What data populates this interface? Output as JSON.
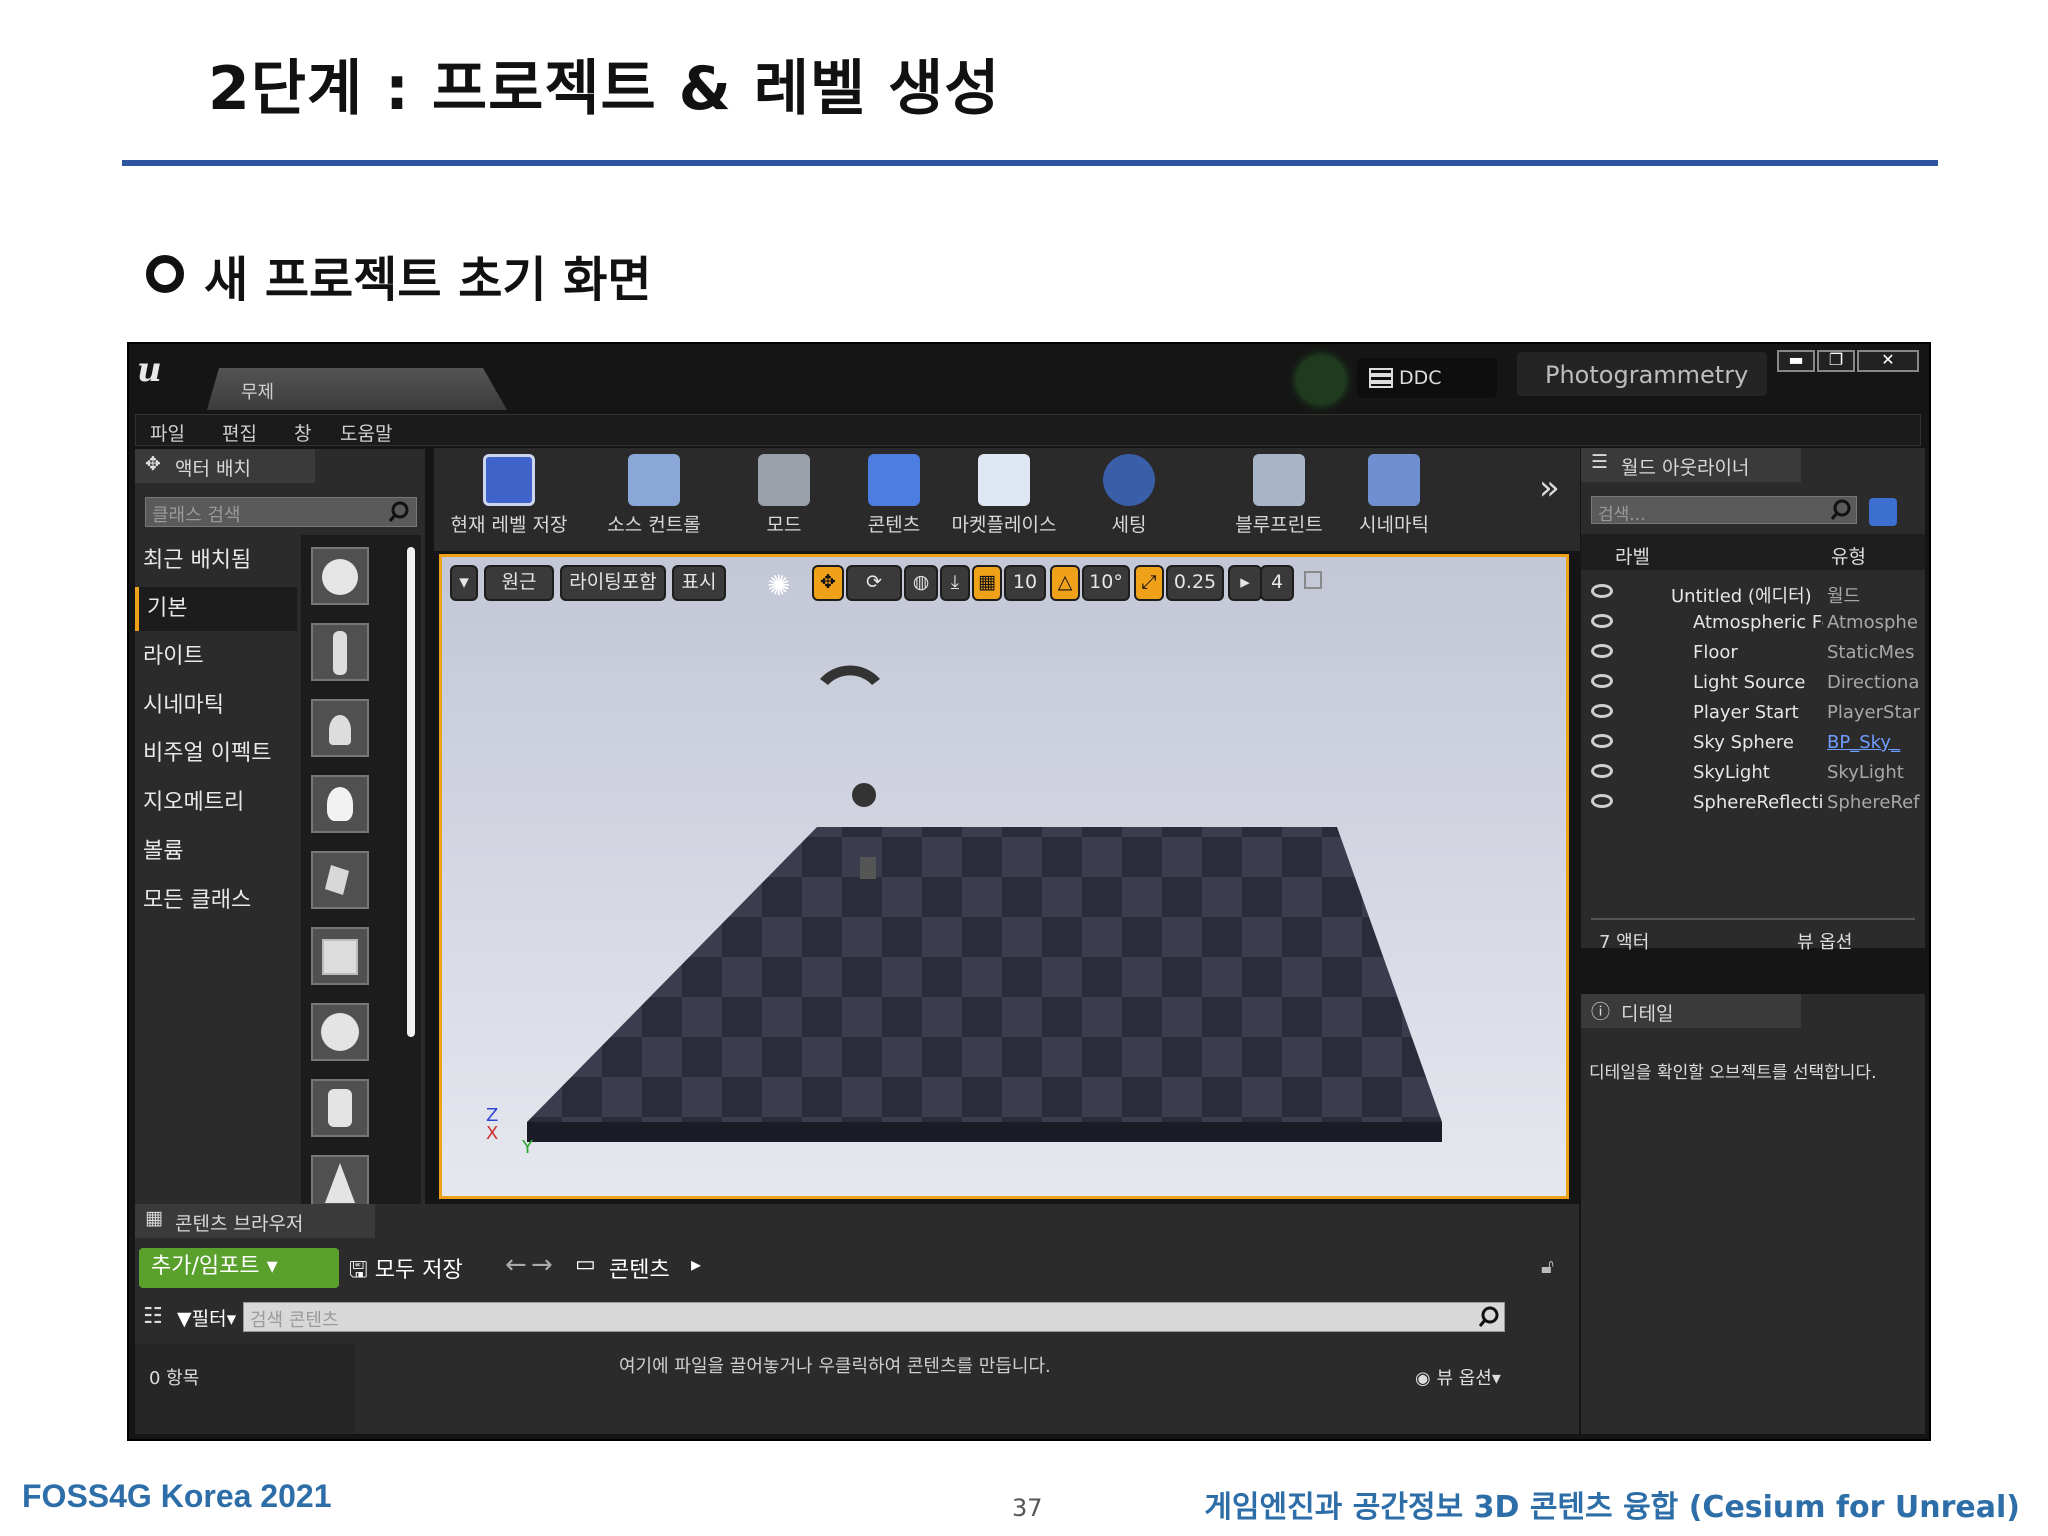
{
  "slide": {
    "title": "2단계 : 프로젝트 & 레벨 생성",
    "subtitle": "새 프로젝트 초기 화면",
    "footer_left": "FOSS4G Korea 2021",
    "page_number": "37",
    "footer_right": "게임엔진과 공간정보 3D 콘텐츠 융합 (Cesium for Unreal)",
    "accent_color": "#2e54a0",
    "footer_color": "#2e6ea8"
  },
  "editor": {
    "logo": "u",
    "level_tab": "무제",
    "ddc_label": "DDC",
    "project_name": "Photogrammetry",
    "window_buttons": [
      "▬",
      "❐",
      "✕"
    ],
    "menu": [
      "파일",
      "편집",
      "창",
      "도움말"
    ],
    "place_actors": {
      "tab": "액터 배치",
      "search_placeholder": "클래스 검색",
      "categories": [
        "최근 배치됨",
        "기본",
        "라이트",
        "시네마틱",
        "비주얼 이펙트",
        "지오메트리",
        "볼륨",
        "모든 클래스"
      ],
      "active_category": "기본"
    },
    "toolbar": [
      "현재 레벨 저장",
      "소스 컨트롤",
      "모드",
      "콘텐츠",
      "마켓플레이스",
      "세팅",
      "블루프린트",
      "시네마틱"
    ],
    "toolbar_more": "»",
    "viewport": {
      "perspective": "원근",
      "view_mode": "라이팅포함",
      "show": "표시",
      "grid_snap": "10",
      "rotation_snap": "10°",
      "scale_snap": "0.25",
      "camera_speed": "4",
      "axis_z": "Z",
      "axis_x": "X",
      "axis_y": "Y"
    },
    "outliner": {
      "tab": "월드 아웃라이너",
      "search_placeholder": "검색...",
      "col_label": "라벨",
      "col_type": "유형",
      "rows": [
        {
          "name": "Untitled (에디터)",
          "type": "월드"
        },
        {
          "name": "Atmospheric Fog",
          "type": "Atmosphe"
        },
        {
          "name": "Floor",
          "type": "StaticMes"
        },
        {
          "name": "Light Source",
          "type": "Directiona"
        },
        {
          "name": "Player Start",
          "type": "PlayerStar"
        },
        {
          "name": "Sky Sphere",
          "type": "BP_Sky_"
        },
        {
          "name": "SkyLight",
          "type": "SkyLight"
        },
        {
          "name": "SphereReflection",
          "type": "SphereRef"
        }
      ],
      "actor_count": "7 액터",
      "view_options": "뷰 옵션"
    },
    "details": {
      "tab": "디테일",
      "empty_message": "디테일을 확인할 오브젝트를 선택합니다."
    },
    "content_browser": {
      "tab": "콘텐츠 브라우저",
      "add_import": "추가/임포트",
      "save_all": "모두 저장",
      "path_root": "콘텐츠",
      "filter": "필터",
      "search_placeholder": "검색 콘텐츠",
      "item_count": "0 항목",
      "empty_message": "여기에 파일을 끌어놓거나 우클릭하여 콘텐츠를 만듭니다.",
      "view_options": "뷰 옵션"
    }
  }
}
